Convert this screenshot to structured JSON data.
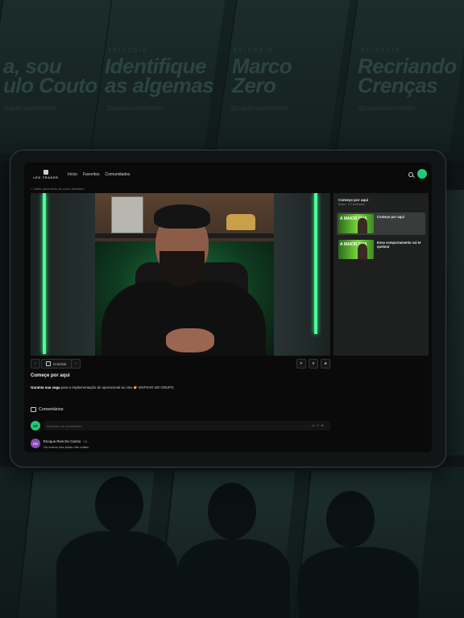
{
  "background": {
    "top_panels": [
      {
        "kicker": "",
        "title_line1": "a, sou",
        "title_line2": "ulo Couto",
        "handle": "paulocoutomentor"
      },
      {
        "kicker": "EPISÓDIO",
        "title_line1": "Identifique",
        "title_line2": "as algemas",
        "handle": "@paulocoutomentor"
      },
      {
        "kicker": "EPISÓDIO",
        "title_line1": "Marco",
        "title_line2": "Zero",
        "handle": "@paulocoutomentor"
      },
      {
        "kicker": "EPISÓDIO",
        "title_line1": "Recriando",
        "title_line2": "Crenças",
        "handle": "@paulocoutomentor"
      }
    ]
  },
  "app": {
    "logo_text": "LEO TRADER",
    "nav": [
      "Início",
      "Favoritos",
      "Comunidades"
    ],
    "back_link": "< Voltar para início do curso definitivo",
    "accent": "#21c87a"
  },
  "player": {
    "concluir_label": "Concluir",
    "prev_icon": "chevron-left-icon",
    "next_icon": "chevron-right-icon"
  },
  "sidebar": {
    "module_title": "Começe por aqui",
    "module_sub": "Aulas · 2 Conteúdos",
    "lessons": [
      {
        "label": "Começe por aqui",
        "thumb_text": "A MAIOR SUA",
        "active": true
      },
      {
        "label": "Esse comportamento vai te quebrar",
        "thumb_text": "A MAIOR SUA",
        "active": false
      }
    ]
  },
  "lesson": {
    "title": "Começe por aqui",
    "desc_bold": "Garanta sua vaga",
    "desc_rest": " para a implementação do operacional ao vivo 👉 ENTRAR NO GRUPO"
  },
  "comments": {
    "header": "Comentários",
    "placeholder": "Adicione um comentário...",
    "current_user_initials": "AT",
    "items": [
      {
        "initials": "ED",
        "name": "Enoque Reis Do Carmo",
        "time": "1a",
        "text": "Os vídeos das aulas não rodam"
      }
    ]
  }
}
